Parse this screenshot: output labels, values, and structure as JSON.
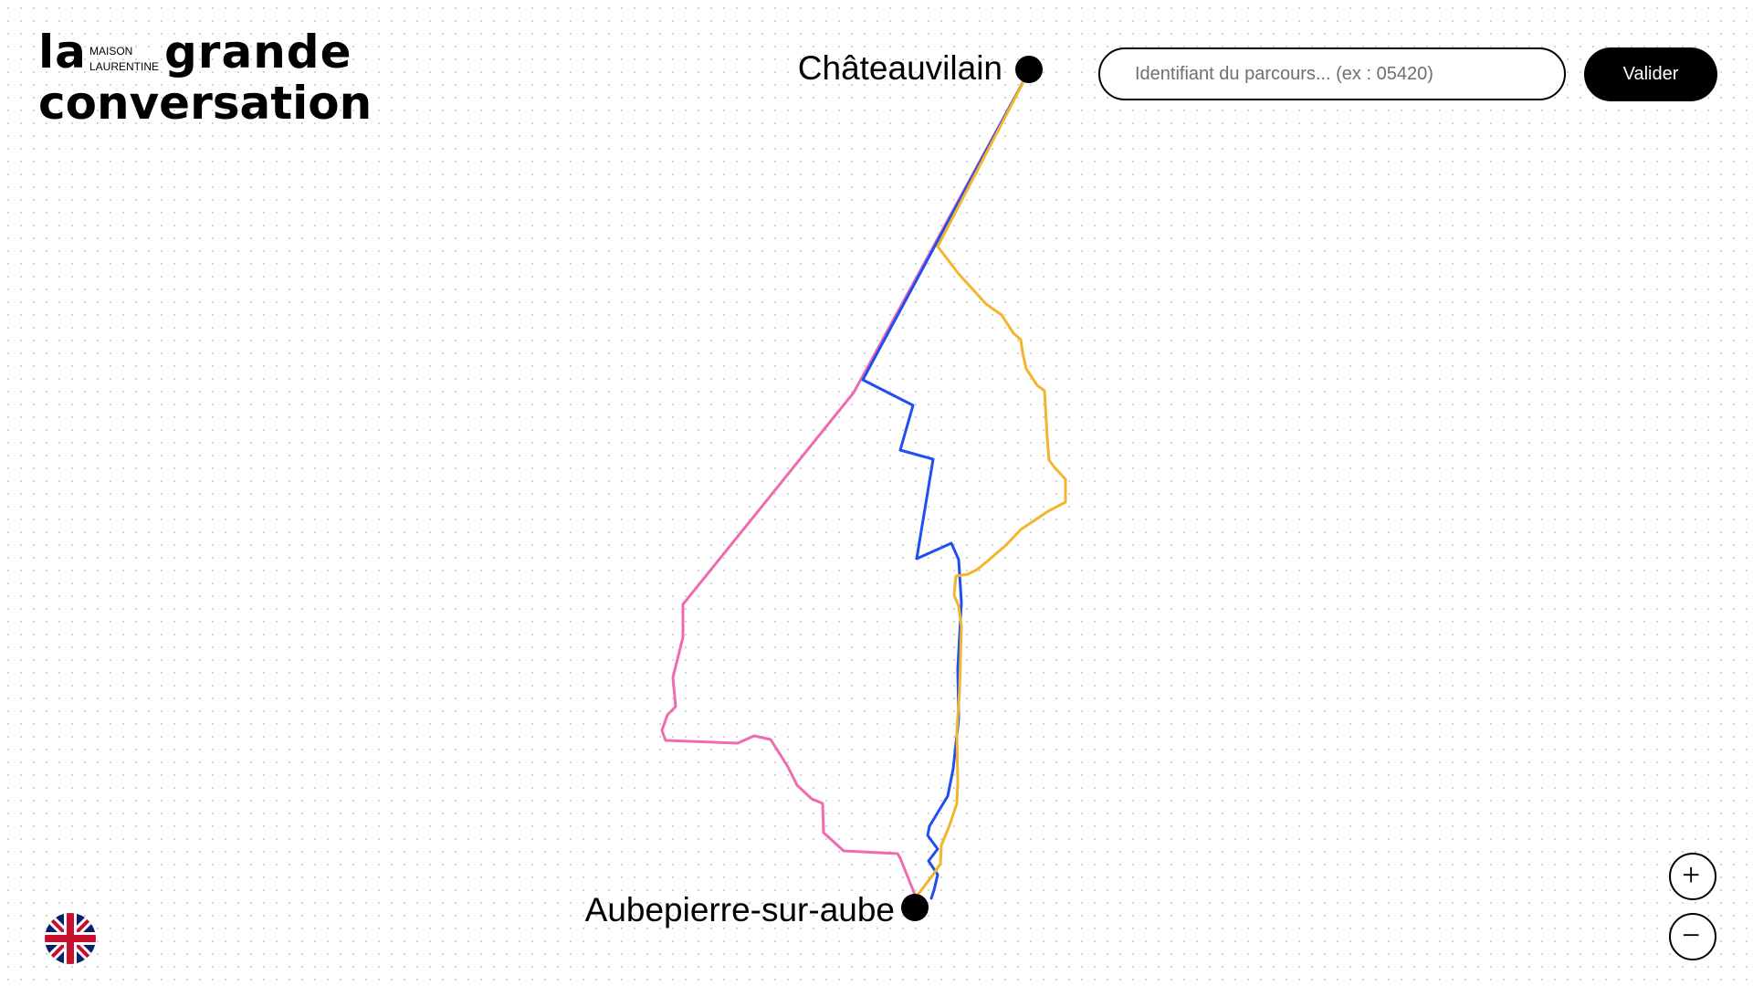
{
  "header": {
    "logo": {
      "word_la": "la",
      "maison_line1": "MAISON",
      "maison_line2": "LAURENTINE",
      "word_grande": "grande",
      "word_conversation": "conversation"
    }
  },
  "search": {
    "placeholder": "Identifiant du parcours... (ex : 05420)",
    "value": "",
    "submit_label": "Valider"
  },
  "map": {
    "start_label": "Châteauvilain",
    "end_label": "Aubepierre-sur-aube",
    "route_colors": {
      "pink": "#f06ab0",
      "blue": "#1f4ff0",
      "yellow": "#f2b52c"
    }
  },
  "controls": {
    "zoom_in_icon": "plus-icon",
    "zoom_out_icon": "minus-icon",
    "language_icon": "uk-flag-icon"
  }
}
